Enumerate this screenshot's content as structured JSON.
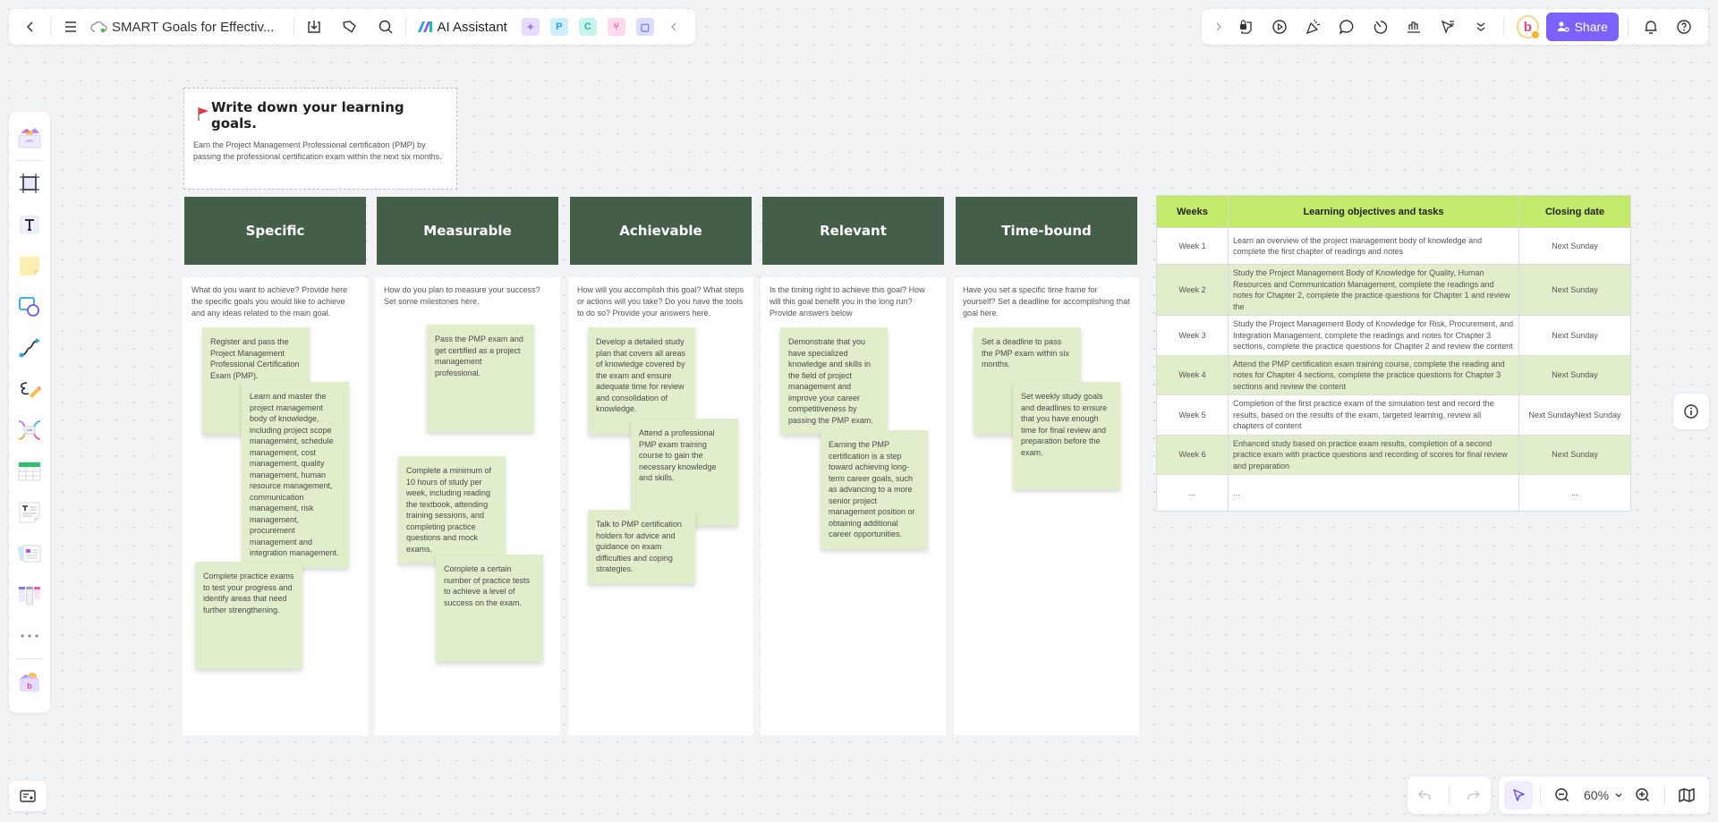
{
  "toolbar_left": {
    "document_title": "SMART Goals for Effectiv...",
    "ai_assistant_label": "AI Assistant",
    "icons": [
      "back-icon",
      "menu-icon",
      "cloud-sync-icon",
      "download-icon",
      "tag-icon",
      "search-icon"
    ],
    "app_shortcuts": [
      {
        "name": "image-app",
        "glyph": "✦",
        "bg": "#e5dcff",
        "fg": "#9b7cf2"
      },
      {
        "name": "p-app",
        "glyph": "P",
        "bg": "#cfeeff",
        "fg": "#2a9df4"
      },
      {
        "name": "c-app",
        "glyph": "C",
        "bg": "#ccf4ee",
        "fg": "#16c2a6"
      },
      {
        "name": "mindmap-app",
        "glyph": "⑂",
        "bg": "#ffd9ec",
        "fg": "#ef4f9c"
      },
      {
        "name": "chat-app",
        "glyph": "▢",
        "bg": "#dcdcff",
        "fg": "#6b6bf0"
      }
    ]
  },
  "toolbar_right": {
    "share_label": "Share",
    "avatar_letter": "b",
    "icons": [
      "expand-icon",
      "lock-file-icon",
      "play-icon",
      "celebrate-icon",
      "comment-icon",
      "timer-icon",
      "chart-icon",
      "pointer-follow-icon",
      "more-icon",
      "bell-icon",
      "help-icon"
    ]
  },
  "left_rail": {
    "tools": [
      "templates",
      "frame",
      "text",
      "sticky-note",
      "shape",
      "connector",
      "pen",
      "mindmap",
      "table",
      "text-doc",
      "cards",
      "kanban",
      "more",
      "my-apps"
    ]
  },
  "goal": {
    "flag": "🚩",
    "title": "Write down your learning goals.",
    "description": "Earn the Project Management Professional certification (PMP) by passing the professional certification exam within the next six months."
  },
  "smart": [
    {
      "title": "Specific",
      "prompt": "What do you want to achieve? Provide here the specific goals you would like to achieve and any ideas related to the main goal.",
      "notes": [
        "Register and pass the Project Management Professional Certification Exam (PMP).",
        "Learn and master the project management body of knowledge, including project scope management, schedule management, cost management, quality management, human resource management, communication management, risk management, procurement management and integration management.",
        "Complete practice exams to test your progress and identify areas that need further strengthening."
      ]
    },
    {
      "title": "Measurable",
      "prompt": "How do you plan to measure your success? Set some milestones here.",
      "notes": [
        "Pass the PMP exam and get certified as a project management professional.",
        "Complete a minimum of 10 hours of study per week, including reading the textbook, attending training sessions, and completing practice questions and mock exams.",
        "Complete a certain number of practice tests to achieve a level of success on the exam."
      ]
    },
    {
      "title": "Achievable",
      "prompt": "How will you accomplish this goal? What steps or actions will you take? Do you have the tools to do so? Provide your answers here.",
      "notes": [
        "Develop a detailed study plan that covers all areas of knowledge covered by the exam and ensure adequate time for review and consolidation of knowledge.",
        "Attend a professional PMP exam training course to gain the necessary knowledge and skills.",
        "Talk to PMP certification holders for advice and guidance on exam difficulties and coping strategies."
      ]
    },
    {
      "title": "Relevant",
      "prompt": "Is the timing right to achieve this goal? How will this goal benefit you in the long run? Provide answers below",
      "notes": [
        "Demonstrate that you have specialized knowledge and skills in the field of project management and improve your career competitiveness by passing the PMP exam.",
        "Earning the PMP certification is a step toward achieving long-term career goals, such as advancing to a more senior project management position or obtaining additional career opportunities."
      ]
    },
    {
      "title": "Time-bound",
      "prompt": "Have you set a specific time frame for yourself? Set a deadline for accomplishing that goal here.",
      "notes": [
        "Set a deadline to pass the PMP exam within six months.",
        "Set weekly study goals and deadlines to ensure that you have enough time for final review and preparation before the exam."
      ]
    }
  ],
  "plan_table": {
    "headers": [
      "Weeks",
      "Learning objectives and tasks",
      "Closing date"
    ],
    "rows": [
      {
        "week": "Week 1",
        "task": "Learn an overview of the project management body of knowledge and complete the first chapter of readings and notes",
        "date": "Next Sunday"
      },
      {
        "week": "Week 2",
        "task": "Study the Project Management Body of Knowledge for Quality, Human Resources and Communication Management, complete the readings and notes for Chapter 2, complete the practice questions for Chapter 1 and review the",
        "date": "Next Sunday"
      },
      {
        "week": "Week 3",
        "task": "Study the Project Management Body of Knowledge for Risk, Procurement, and Integration Management, complete the readings and notes for Chapter 3 sections, complete the practice questions for Chapter 2 and review the content",
        "date": "Next Sunday"
      },
      {
        "week": "Week 4",
        "task": "Attend the PMP certification exam training course, complete the reading and notes for Chapter 4 sections, complete the practice questions for Chapter 3 sections and review the content",
        "date": "Next Sunday"
      },
      {
        "week": "Week 5",
        "task": "Completion of the first practice exam of the simulation test and record the results, based on the results of the exam, targeted learning, review all chapters of content",
        "date": "Next SundayNext Sunday"
      },
      {
        "week": "Week 6",
        "task": "Enhanced study based on practice exam results, completion of a second practice exam with practice questions and recording of scores for final review and preparation",
        "date": "Next Sunday"
      },
      {
        "week": "...",
        "task": "...",
        "date": "..."
      }
    ]
  },
  "zoom_controls": {
    "zoom_level": "60%"
  },
  "colors": {
    "accent": "#7b61ff",
    "smart_header": "#445e4a",
    "sticky": "#e0eecb",
    "table_header": "#c3ea6b"
  }
}
